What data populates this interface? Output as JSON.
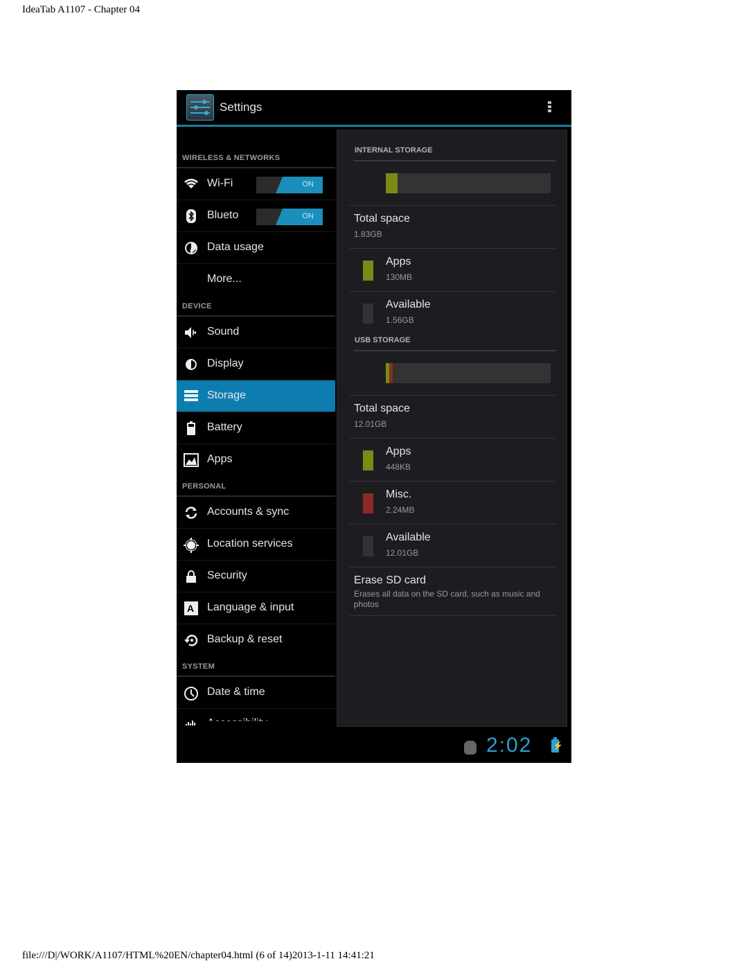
{
  "doc": {
    "header": "IdeaTab A1107 - Chapter 04",
    "footer": "file:///D|/WORK/A1107/HTML%20EN/chapter04.html (6 of 14)2013-1-11 14:41:21"
  },
  "actionbar": {
    "title": "Settings",
    "app_icon": "settings-sliders-icon",
    "overflow_icon": "overflow-menu-icon"
  },
  "sidebar": {
    "categories": [
      {
        "label": "WIRELESS & NETWORKS",
        "items": [
          {
            "label": "Wi-Fi",
            "icon": "wifi-icon",
            "toggle": "ON"
          },
          {
            "label": "Blueto",
            "icon": "bluetooth-icon",
            "toggle": "ON"
          },
          {
            "label": "Data usage",
            "icon": "data-usage-icon"
          },
          {
            "label": "More...",
            "icon": ""
          }
        ]
      },
      {
        "label": "DEVICE",
        "items": [
          {
            "label": "Sound",
            "icon": "sound-icon"
          },
          {
            "label": "Display",
            "icon": "display-icon"
          },
          {
            "label": "Storage",
            "icon": "storage-icon",
            "selected": true
          },
          {
            "label": "Battery",
            "icon": "battery-icon"
          },
          {
            "label": "Apps",
            "icon": "apps-icon"
          }
        ]
      },
      {
        "label": "PERSONAL",
        "items": [
          {
            "label": "Accounts & sync",
            "icon": "sync-icon"
          },
          {
            "label": "Location services",
            "icon": "location-icon"
          },
          {
            "label": "Security",
            "icon": "lock-icon"
          },
          {
            "label": "Language & input",
            "icon": "language-icon"
          },
          {
            "label": "Backup & reset",
            "icon": "backup-icon"
          }
        ]
      },
      {
        "label": "SYSTEM",
        "items": [
          {
            "label": "Date & time",
            "icon": "clock-icon"
          },
          {
            "label": "Accessibility",
            "icon": "accessibility-icon"
          }
        ]
      }
    ]
  },
  "storage": {
    "internal": {
      "header": "INTERNAL STORAGE",
      "usage_fractions": {
        "apps": 0.07,
        "misc": 0,
        "available": 0.93
      },
      "total_label": "Total space",
      "total_value": "1.83GB",
      "apps_label": "Apps",
      "apps_value": "130MB",
      "available_label": "Available",
      "available_value": "1.56GB"
    },
    "usb": {
      "header": "USB STORAGE",
      "usage_fractions": {
        "apps": 0.02,
        "misc": 0.02,
        "available": 0.96
      },
      "total_label": "Total space",
      "total_value": "12.01GB",
      "apps_label": "Apps",
      "apps_value": "448KB",
      "misc_label": "Misc.",
      "misc_value": "2.24MB",
      "available_label": "Available",
      "available_value": "12.01GB"
    },
    "erase": {
      "title": "Erase SD card",
      "subtitle": "Erases all data on the SD card, such as music and photos"
    },
    "colors": {
      "apps": "#7a8a14",
      "misc": "#8a2a22",
      "available": "#333333"
    }
  },
  "statusbar": {
    "time": "2:02",
    "notification_icon": "android-debug-icon",
    "battery_icon": "battery-charging-icon"
  }
}
